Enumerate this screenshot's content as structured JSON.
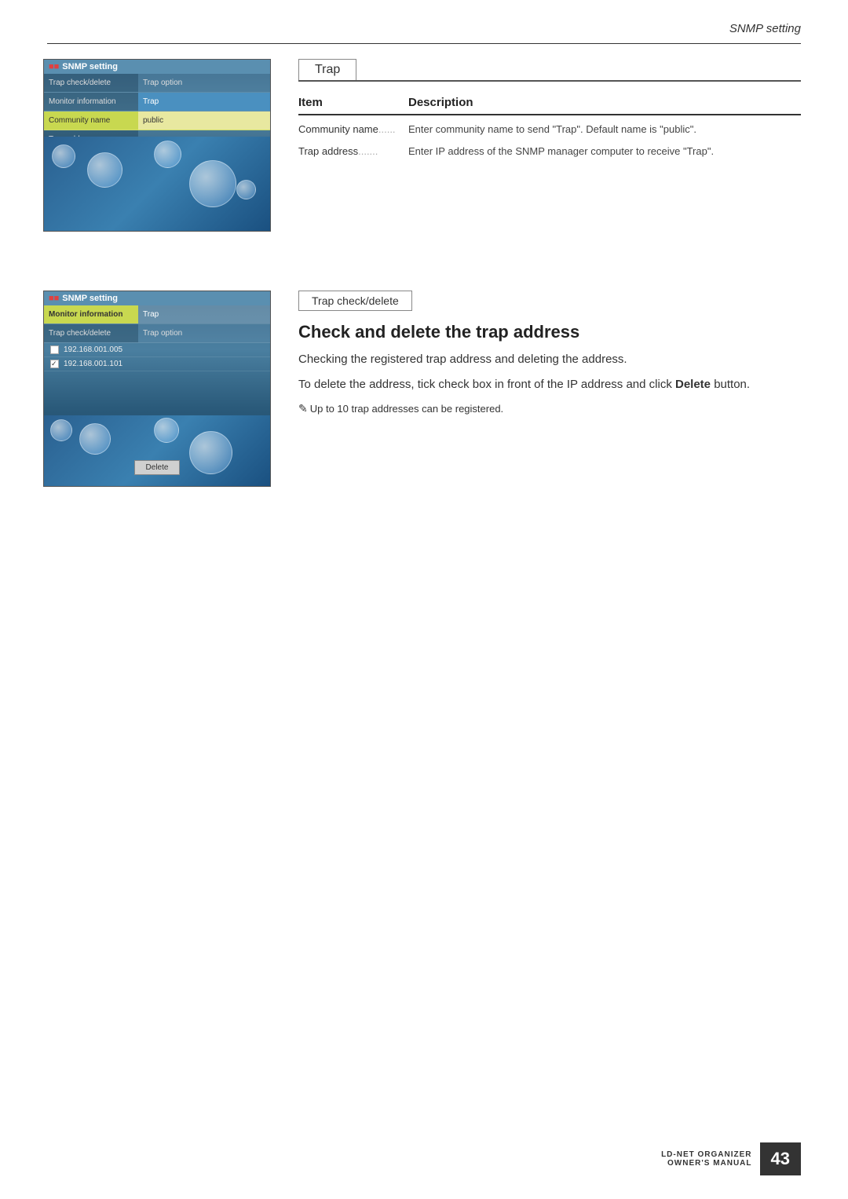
{
  "page": {
    "title": "SNMP setting",
    "page_number": "43",
    "brand_line1": "LD-NET ORGANIZER",
    "brand_line2": "OWNER'S MANUAL"
  },
  "section1": {
    "tab_label": "Trap",
    "table": {
      "col_item": "Item",
      "col_desc": "Description",
      "rows": [
        {
          "item": "Community name",
          "dots": "......",
          "description": "Enter community name to send \"Trap\". Default name is \"public\"."
        },
        {
          "item": "Trap address",
          "dots": ".......",
          "description": "Enter IP address of the SNMP manager computer to receive \"Trap\"."
        }
      ]
    }
  },
  "section2": {
    "tab_label": "Trap check/delete",
    "heading": "Check and delete the trap address",
    "body1": "Checking the registered trap address and deleting the address.",
    "body2": "To delete the address, tick check box in front of the IP address and click ",
    "body2_bold": "Delete",
    "body2_end": " button.",
    "note": "Up to 10 trap addresses can be registered."
  },
  "panel1": {
    "title": "SNMP setting",
    "nav_rows": [
      {
        "left": "Trap check/delete",
        "right": "Trap option",
        "left_active": false,
        "right_active": false
      },
      {
        "left": "Monitor information",
        "right": "Trap",
        "left_active": false,
        "right_active": true
      },
      {
        "left": "Community name",
        "right": "public",
        "left_active": true,
        "right_active": false
      },
      {
        "left": "Trap address",
        "right": "",
        "left_active": false,
        "right_active": false
      }
    ]
  },
  "panel2": {
    "title": "SNMP setting",
    "nav_rows": [
      {
        "left": "Monitor information",
        "right": "Trap",
        "left_active": true,
        "right_active": false
      },
      {
        "left": "Trap check/delete",
        "right": "Trap option",
        "left_active": false,
        "right_active": false
      }
    ],
    "addresses": [
      {
        "ip": "192.168.001.005",
        "checked": false
      },
      {
        "ip": "192.168.001.101",
        "checked": true
      }
    ],
    "delete_button": "Delete"
  }
}
